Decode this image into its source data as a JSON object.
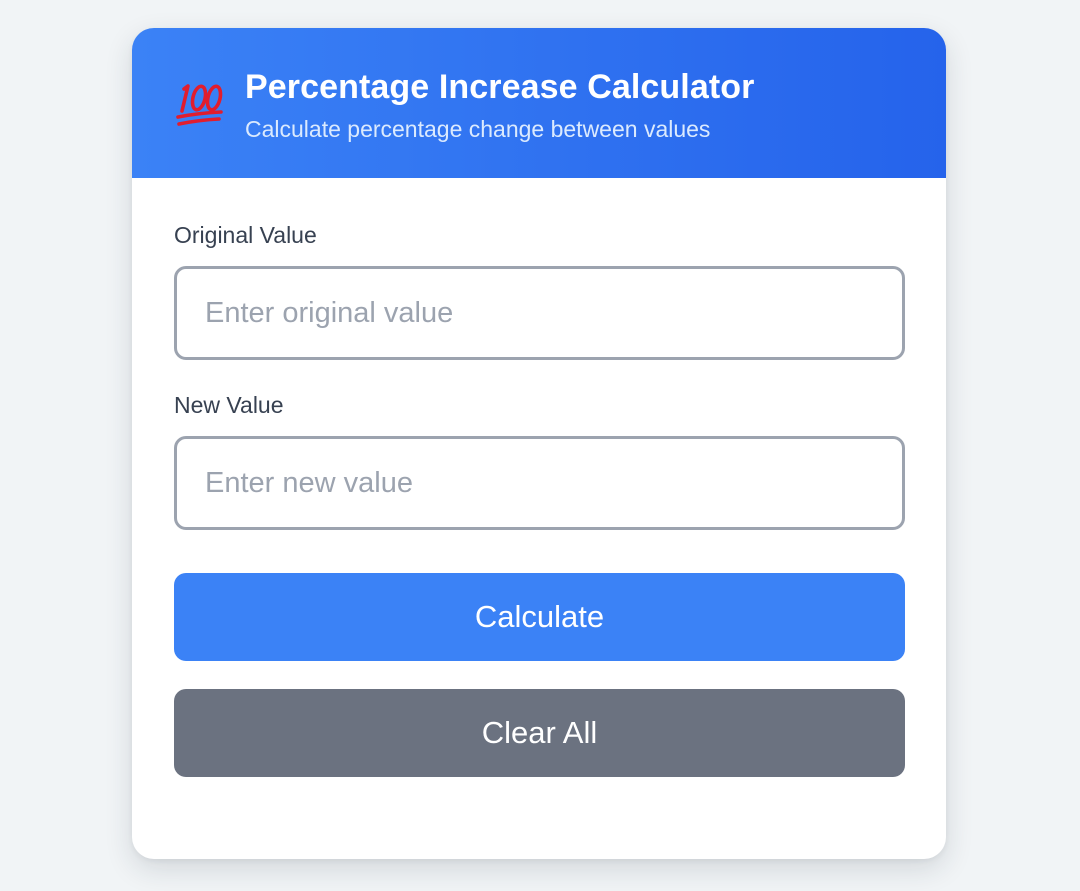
{
  "header": {
    "icon": "hundred-points-icon",
    "title": "Percentage Increase Calculator",
    "subtitle": "Calculate percentage change between values"
  },
  "form": {
    "original": {
      "label": "Original Value",
      "value": "",
      "placeholder": "Enter original value"
    },
    "new": {
      "label": "New Value",
      "value": "",
      "placeholder": "Enter new value"
    }
  },
  "buttons": {
    "calculate_label": "Calculate",
    "clear_label": "Clear All"
  },
  "colors": {
    "accent": "#3b82f6",
    "header_gradient_end": "#2563eb",
    "secondary_button": "#6b7280",
    "page_background": "#f1f4f6",
    "icon_red": "#e11d2e"
  }
}
